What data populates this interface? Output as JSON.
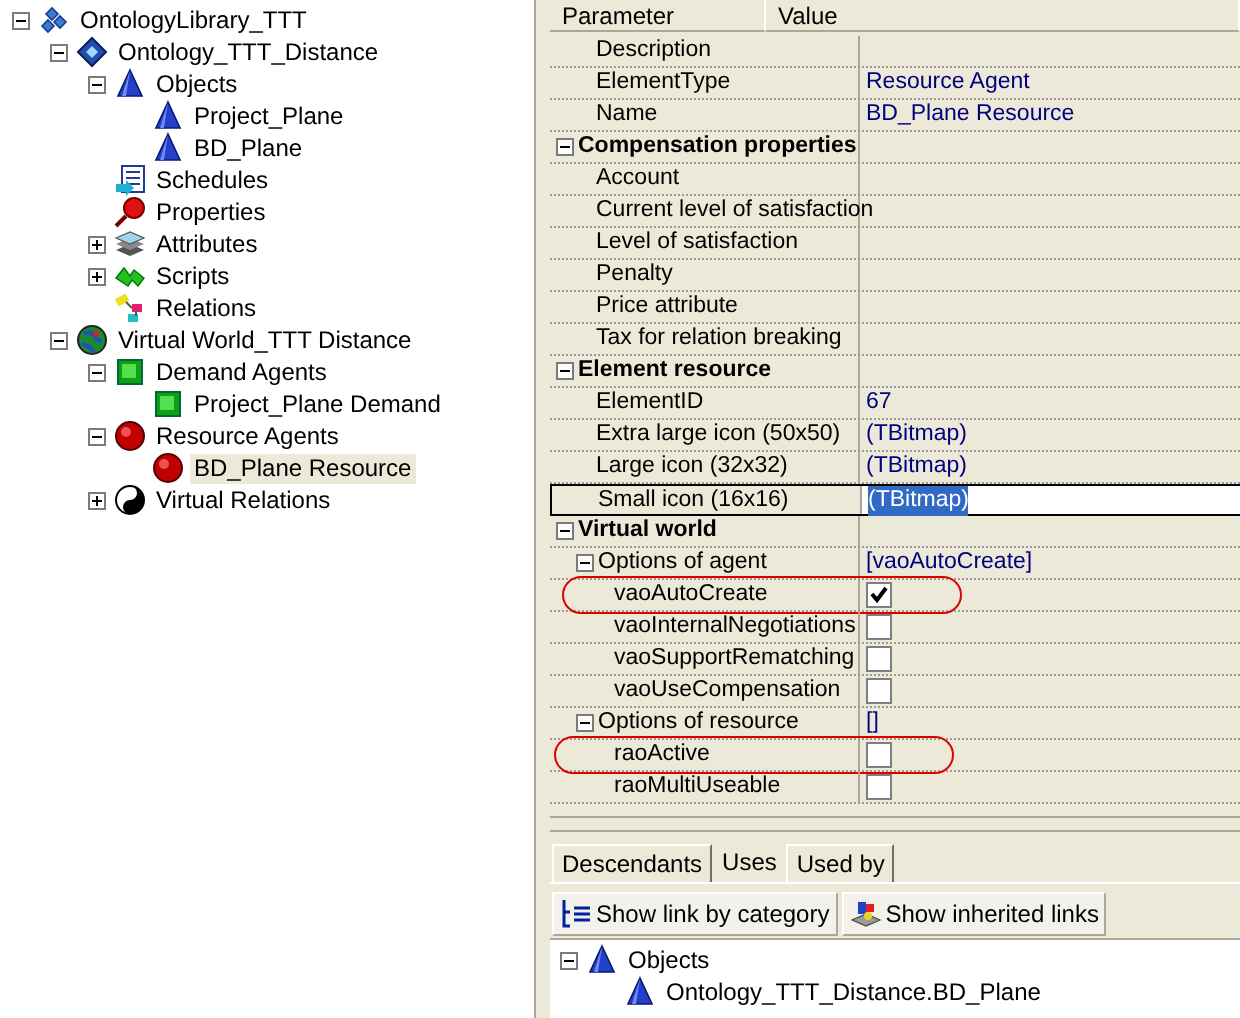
{
  "tree": [
    {
      "label": "OntologyLibrary_TTT",
      "kind": "library",
      "expanded": true,
      "selected": false,
      "children": [
        {
          "label": "Ontology_TTT_Distance",
          "kind": "ontology",
          "expanded": true,
          "selected": false,
          "children": [
            {
              "label": "Objects",
              "kind": "cone",
              "expanded": true,
              "selected": false,
              "children": [
                {
                  "label": "Project_Plane",
                  "kind": "cone",
                  "selected": false
                },
                {
                  "label": "BD_Plane",
                  "kind": "cone",
                  "selected": false
                }
              ]
            },
            {
              "label": "Schedules",
              "kind": "schedule",
              "selected": false
            },
            {
              "label": "Properties",
              "kind": "property",
              "selected": false
            },
            {
              "label": "Attributes",
              "kind": "attributes",
              "expanded": false,
              "selected": false
            },
            {
              "label": "Scripts",
              "kind": "scripts",
              "expanded": false,
              "selected": false
            },
            {
              "label": "Relations",
              "kind": "relations",
              "selected": false
            }
          ]
        },
        {
          "label": "Virtual World_TTT Distance",
          "kind": "world",
          "expanded": true,
          "selected": false,
          "children": [
            {
              "label": "Demand Agents",
              "kind": "demand",
              "expanded": true,
              "selected": false,
              "children": [
                {
                  "label": "Project_Plane Demand",
                  "kind": "demand",
                  "selected": false
                }
              ]
            },
            {
              "label": "Resource Agents",
              "kind": "resource",
              "expanded": true,
              "selected": false,
              "children": [
                {
                  "label": "BD_Plane Resource",
                  "kind": "resource",
                  "selected": true
                }
              ]
            },
            {
              "label": "Virtual Relations",
              "kind": "yinyang",
              "expanded": false,
              "selected": false
            }
          ]
        }
      ]
    }
  ],
  "grid": {
    "columns": [
      "Parameter",
      "Value"
    ],
    "rows": [
      {
        "kind": "property",
        "label": "Description"
      },
      {
        "kind": "property",
        "label": "ElementType",
        "value": "Resource Agent"
      },
      {
        "kind": "property",
        "label": "Name",
        "value": "BD_Plane Resource"
      },
      {
        "kind": "category",
        "label": "Compensation properties",
        "expanded": true,
        "children": [
          {
            "kind": "property",
            "label": "Account"
          },
          {
            "kind": "property",
            "label": "Current level of satisfaction"
          },
          {
            "kind": "property",
            "label": "Level of satisfaction"
          },
          {
            "kind": "property",
            "label": "Penalty"
          },
          {
            "kind": "property",
            "label": "Price attribute"
          },
          {
            "kind": "property",
            "label": "Tax for relation breaking"
          }
        ]
      },
      {
        "kind": "category",
        "label": "Element resource",
        "expanded": true,
        "children": [
          {
            "kind": "property",
            "label": "ElementID",
            "value": "67"
          },
          {
            "kind": "property",
            "label": "Extra large icon (50x50)",
            "value": "(TBitmap)"
          },
          {
            "kind": "property",
            "label": "Large icon (32x32)",
            "value": "(TBitmap)"
          },
          {
            "kind": "property",
            "label": "Small icon (16x16)",
            "value": "(TBitmap)",
            "editing": true
          }
        ]
      },
      {
        "kind": "category",
        "label": "Virtual world",
        "expanded": true,
        "children": [
          {
            "kind": "group",
            "label": "Options of agent",
            "value": "[vaoAutoCreate]",
            "expanded": true,
            "children": [
              {
                "kind": "checkbox",
                "label": "vaoAutoCreate",
                "checked": true,
                "circled": true
              },
              {
                "kind": "checkbox",
                "label": "vaoInternalNegotiations",
                "checked": false,
                "circled": false
              },
              {
                "kind": "checkbox",
                "label": "vaoSupportRematching",
                "checked": false,
                "circled": false
              },
              {
                "kind": "checkbox",
                "label": "vaoUseCompensation",
                "checked": false,
                "circled": false
              }
            ]
          },
          {
            "kind": "group",
            "label": "Options of resource",
            "value": "[]",
            "expanded": true,
            "children": [
              {
                "kind": "checkbox",
                "label": "raoActive",
                "checked": false,
                "circled": true
              },
              {
                "kind": "checkbox",
                "label": "raoMultiUseable",
                "checked": false,
                "circled": false
              }
            ]
          }
        ]
      }
    ]
  },
  "tabs": [
    {
      "label": "Descendants",
      "selected": false
    },
    {
      "label": "Uses",
      "selected": true
    },
    {
      "label": "Used by",
      "selected": false
    }
  ],
  "toolbar": [
    {
      "label": "Show link by category",
      "kind": "category"
    },
    {
      "label": "Show inherited links",
      "kind": "inherited"
    }
  ],
  "links": [
    {
      "label": "Objects",
      "kind": "cone",
      "expanded": true,
      "children": [
        {
          "label": "Ontology_TTT_Distance.BD_Plane",
          "kind": "cone"
        }
      ]
    }
  ]
}
